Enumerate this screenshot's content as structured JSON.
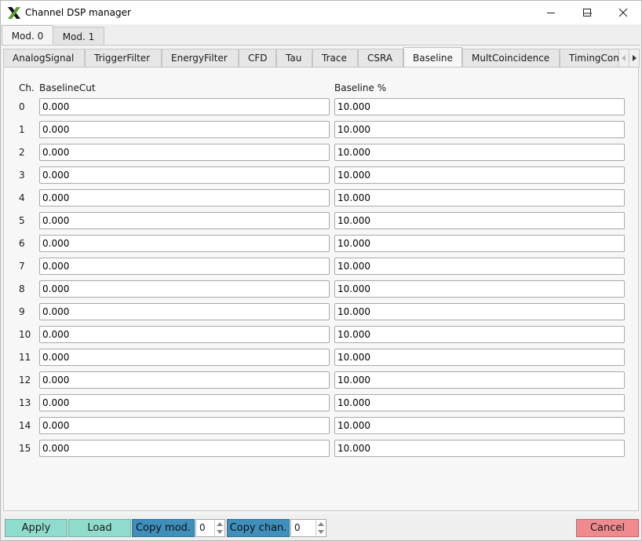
{
  "window": {
    "title": "Channel DSP manager"
  },
  "module_tabs": [
    "Mod. 0",
    "Mod. 1"
  ],
  "dsp_tabs": [
    "AnalogSignal",
    "TriggerFilter",
    "EnergyFilter",
    "CFD",
    "Tau",
    "Trace",
    "CSRA",
    "Baseline",
    "MultCoincidence",
    "TimingCon"
  ],
  "active_dsp_tab": "Baseline",
  "table": {
    "headers": {
      "channel": "Ch.",
      "baseline_cut": "BaselineCut",
      "baseline_percent": "Baseline %"
    },
    "rows": [
      {
        "ch": "0",
        "baseline_cut": "0.000",
        "baseline_percent": "10.000"
      },
      {
        "ch": "1",
        "baseline_cut": "0.000",
        "baseline_percent": "10.000"
      },
      {
        "ch": "2",
        "baseline_cut": "0.000",
        "baseline_percent": "10.000"
      },
      {
        "ch": "3",
        "baseline_cut": "0.000",
        "baseline_percent": "10.000"
      },
      {
        "ch": "4",
        "baseline_cut": "0.000",
        "baseline_percent": "10.000"
      },
      {
        "ch": "5",
        "baseline_cut": "0.000",
        "baseline_percent": "10.000"
      },
      {
        "ch": "6",
        "baseline_cut": "0.000",
        "baseline_percent": "10.000"
      },
      {
        "ch": "7",
        "baseline_cut": "0.000",
        "baseline_percent": "10.000"
      },
      {
        "ch": "8",
        "baseline_cut": "0.000",
        "baseline_percent": "10.000"
      },
      {
        "ch": "9",
        "baseline_cut": "0.000",
        "baseline_percent": "10.000"
      },
      {
        "ch": "10",
        "baseline_cut": "0.000",
        "baseline_percent": "10.000"
      },
      {
        "ch": "11",
        "baseline_cut": "0.000",
        "baseline_percent": "10.000"
      },
      {
        "ch": "12",
        "baseline_cut": "0.000",
        "baseline_percent": "10.000"
      },
      {
        "ch": "13",
        "baseline_cut": "0.000",
        "baseline_percent": "10.000"
      },
      {
        "ch": "14",
        "baseline_cut": "0.000",
        "baseline_percent": "10.000"
      },
      {
        "ch": "15",
        "baseline_cut": "0.000",
        "baseline_percent": "10.000"
      }
    ]
  },
  "bottom_bar": {
    "apply_label": "Apply",
    "load_label": "Load",
    "copy_mod_label": "Copy mod.",
    "copy_mod_value": "0",
    "copy_chan_label": "Copy chan.",
    "copy_chan_value": "0",
    "cancel_label": "Cancel"
  },
  "icons": {
    "app": "x-logo-icon",
    "minimize": "minimize-icon",
    "maximize": "maximize-icon",
    "close": "close-icon",
    "tab_left": "chevron-left-icon",
    "tab_right": "chevron-right-icon"
  },
  "colors": {
    "apply_load": "#8fdccc",
    "copy": "#3f8fbc",
    "cancel": "#ef8a8f"
  }
}
